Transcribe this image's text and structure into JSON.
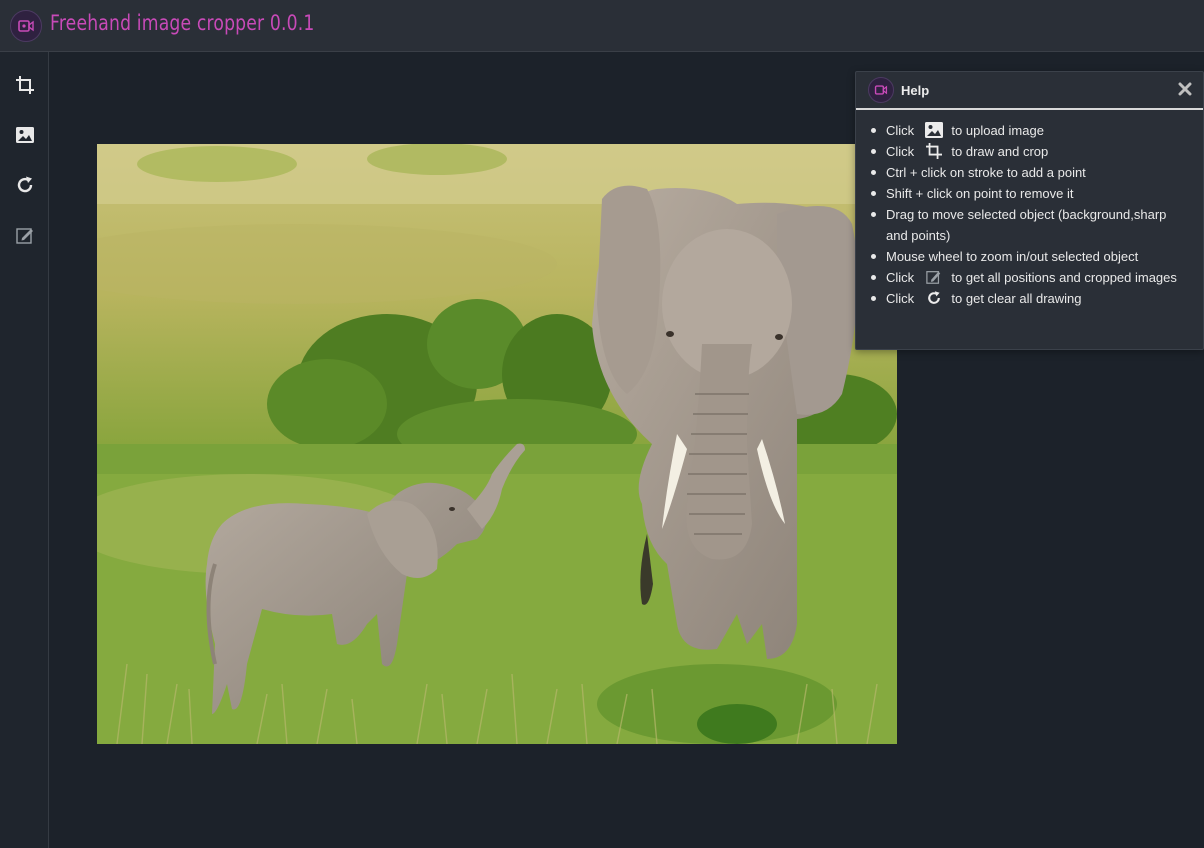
{
  "header": {
    "title": "Freehand image cropper 0.0.1",
    "logo_icon": "video-camera-logo"
  },
  "sidebar": {
    "tools": [
      {
        "name": "crop-tool",
        "icon": "crop-icon"
      },
      {
        "name": "upload-image",
        "icon": "image-icon"
      },
      {
        "name": "clear-drawing",
        "icon": "refresh-icon"
      },
      {
        "name": "get-positions",
        "icon": "edit-icon"
      }
    ]
  },
  "canvas": {
    "image_description": "elephant-mother-and-calf-photo"
  },
  "help": {
    "title": "Help",
    "close_icon": "close-icon",
    "items": [
      {
        "pre": "Click",
        "icon": "image-icon",
        "post": "to upload image"
      },
      {
        "pre": "Click",
        "icon": "crop-icon",
        "post": "to draw and crop"
      },
      {
        "text": "Ctrl + click on stroke to add a point"
      },
      {
        "text": "Shift + click on point to remove it"
      },
      {
        "text": "Drag to move selected object (background,sharp and points)"
      },
      {
        "text": "Mouse wheel to zoom in/out selected object"
      },
      {
        "pre": "Click",
        "icon": "edit-icon",
        "post": "to get all positions and cropped images"
      },
      {
        "pre": "Click",
        "icon": "refresh-icon",
        "post": "to get clear all drawing"
      }
    ]
  },
  "colors": {
    "title_accent": "#c84ab8",
    "background": "#1c222a",
    "panel": "#2a2f37"
  }
}
